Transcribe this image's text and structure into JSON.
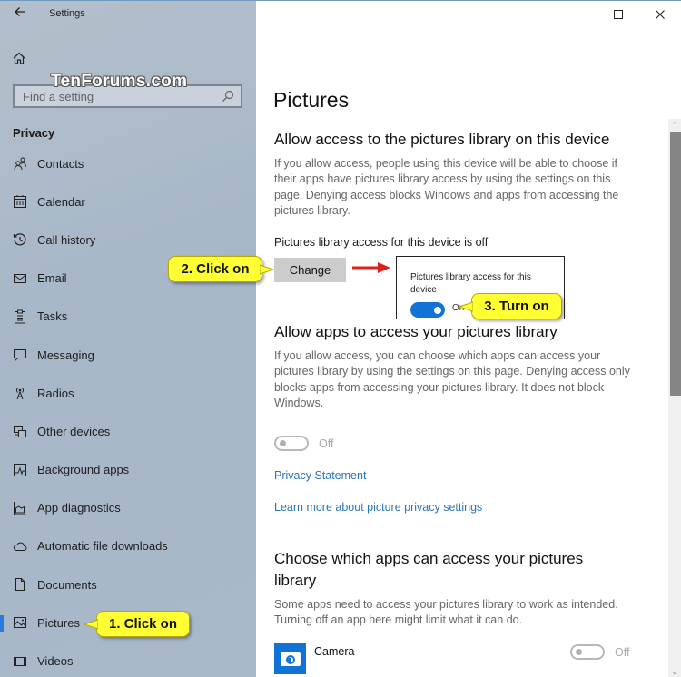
{
  "window": {
    "app_title": "Settings",
    "watermark": "TenForums.com",
    "controls": {
      "minimize": "minimize-icon",
      "maximize": "maximize-icon",
      "close": "close-icon"
    }
  },
  "sidebar": {
    "search": {
      "placeholder": "Find a setting",
      "value": ""
    },
    "section_label": "Privacy",
    "items": [
      {
        "label": "Contacts",
        "icon": "contacts-icon"
      },
      {
        "label": "Calendar",
        "icon": "calendar-icon"
      },
      {
        "label": "Call history",
        "icon": "call-history-icon"
      },
      {
        "label": "Email",
        "icon": "email-icon"
      },
      {
        "label": "Tasks",
        "icon": "tasks-icon"
      },
      {
        "label": "Messaging",
        "icon": "messaging-icon"
      },
      {
        "label": "Radios",
        "icon": "radios-icon"
      },
      {
        "label": "Other devices",
        "icon": "other-devices-icon"
      },
      {
        "label": "Background apps",
        "icon": "background-apps-icon"
      },
      {
        "label": "App diagnostics",
        "icon": "app-diagnostics-icon"
      },
      {
        "label": "Automatic file downloads",
        "icon": "cloud-icon"
      },
      {
        "label": "Documents",
        "icon": "documents-icon"
      },
      {
        "label": "Pictures",
        "icon": "pictures-icon",
        "active": true
      },
      {
        "label": "Videos",
        "icon": "videos-icon"
      }
    ]
  },
  "main": {
    "page_title": "Pictures",
    "device_access": {
      "heading": "Allow access to the pictures library on this device",
      "description": " If you allow access, people using this device will be able to choose if their apps have pictures library access by using the settings on this page. Denying access blocks Windows and apps from accessing the pictures library.",
      "status": "Pictures library access for this device is off",
      "change_label": "Change"
    },
    "flyout": {
      "label": "Pictures library access for this device",
      "toggle_state": "On",
      "toggle_on": true
    },
    "app_access": {
      "heading": "Allow apps to access your pictures library",
      "description": " If you allow access, you can choose which apps can access your pictures library by using the settings on this page. Denying access only blocks apps from accessing your pictures library. It does not block Windows.",
      "toggle_state": "Off",
      "toggle_on": false
    },
    "links": {
      "privacy_statement": "Privacy Statement",
      "learn_more": "Learn more about picture privacy settings"
    },
    "choose_apps": {
      "heading": "Choose which apps can access your pictures library",
      "description": "Some apps need to access your pictures library to work as intended. Turning off an app here might limit what it can do.",
      "apps": [
        {
          "name": "Camera",
          "icon": "camera-icon",
          "toggle_state": "Off",
          "toggle_on": false
        }
      ]
    }
  },
  "annotations": {
    "step1": "1. Click on",
    "step2": "2. Click on",
    "step3": "3. Turn on",
    "callout_color": "#ffff33",
    "arrow_color": "#e0201b"
  },
  "colors": {
    "accent": "#1273d6",
    "link": "#2a74c0",
    "sidebar_bg": "#a9b9c9"
  }
}
